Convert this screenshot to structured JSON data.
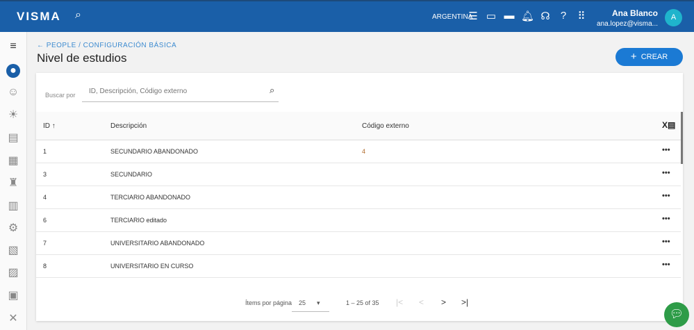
{
  "header": {
    "logo": "VISMA",
    "country": "ARGENTINA",
    "user_name": "Ana Blanco",
    "user_email": "ana.lopez@visma...",
    "avatar_initial": "A"
  },
  "breadcrumb": {
    "root": "PEOPLE",
    "separator": "/",
    "current": "CONFIGURACIÓN BÁSICA"
  },
  "page_title": "Nivel de estudios",
  "create_label": "CREAR",
  "search": {
    "label": "Buscar por",
    "placeholder": "ID, Descripción, Código externo"
  },
  "table": {
    "columns": [
      "ID ↑",
      "Descripción",
      "Código externo"
    ],
    "rows": [
      {
        "id": "1",
        "desc": "SECUNDARIO ABANDONADO",
        "code": "4"
      },
      {
        "id": "3",
        "desc": "SECUNDARIO",
        "code": ""
      },
      {
        "id": "4",
        "desc": "TERCIARIO ABANDONADO",
        "code": ""
      },
      {
        "id": "6",
        "desc": "TERCIARIO editado",
        "code": ""
      },
      {
        "id": "7",
        "desc": "UNIVERSITARIO ABANDONADO",
        "code": ""
      },
      {
        "id": "8",
        "desc": "UNIVERSITARIO EN CURSO",
        "code": ""
      }
    ]
  },
  "pagination": {
    "label": "Ítems por página",
    "page_size": "25",
    "range": "1 – 25 of 35"
  },
  "colors": {
    "header": "#1a5fa8",
    "accent": "#1b7ad4",
    "chat": "#2e9c48"
  }
}
